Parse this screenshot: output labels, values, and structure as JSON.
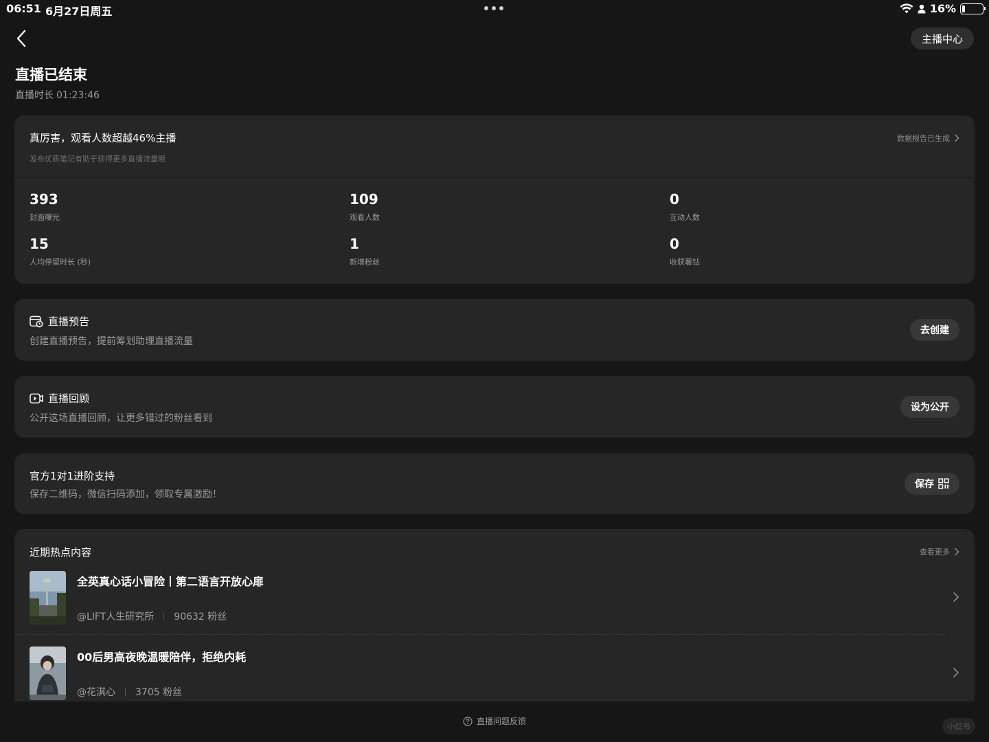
{
  "status_bar": {
    "time": "06:51",
    "date": "6月27日周五",
    "battery": "16%",
    "battery_level": 0.16
  },
  "header": {
    "anchor_center_label": "主播中心",
    "title": "直播已结束",
    "duration_label": "直播时长",
    "duration_value": "01:23:46"
  },
  "stats": {
    "headline": "真厉害，观看人数超越46%主播",
    "subtext": "发布优质笔记有助于获得更多直播流量哦",
    "report_link": "数据报告已生成",
    "metrics": [
      {
        "value": "393",
        "label": "封面曝光"
      },
      {
        "value": "109",
        "label": "观看人数"
      },
      {
        "value": "0",
        "label": "互动人数"
      },
      {
        "value": "15",
        "label": "人均停留时长 (秒)"
      },
      {
        "value": "1",
        "label": "新增粉丝"
      },
      {
        "value": "0",
        "label": "收获薯钻"
      }
    ]
  },
  "preview_card": {
    "title": "直播预告",
    "desc": "创建直播预告，提前筹划助理直播流量",
    "button": "去创建",
    "icon": "calendar-clock-icon"
  },
  "replay_card": {
    "title": "直播回顾",
    "desc": "公开这场直播回顾，让更多错过的粉丝看到",
    "button": "设为公开",
    "icon": "video-replay-icon"
  },
  "support_card": {
    "title": "官方1对1进阶支持",
    "desc": "保存二维码，微信扫码添加，领取专属激励！",
    "button": "保存",
    "icon": "qr-code-icon"
  },
  "hot": {
    "title": "近期热点内容",
    "more": "查看更多",
    "items": [
      {
        "title": "全英真心话小冒险丨第二语言开放心扉",
        "author": "@LIFT人生研究所",
        "fans": "90632 粉丝"
      },
      {
        "title": "00后男高夜晚温暖陪伴，拒绝内耗",
        "author": "@花淇心",
        "fans": "3705 粉丝"
      }
    ]
  },
  "footer": {
    "feedback": "直播问题反馈",
    "watermark": "小红书"
  },
  "colors": {
    "background": "#161616",
    "card": "#262626",
    "button": "#383838",
    "muted_text": "#9a9a9a"
  }
}
